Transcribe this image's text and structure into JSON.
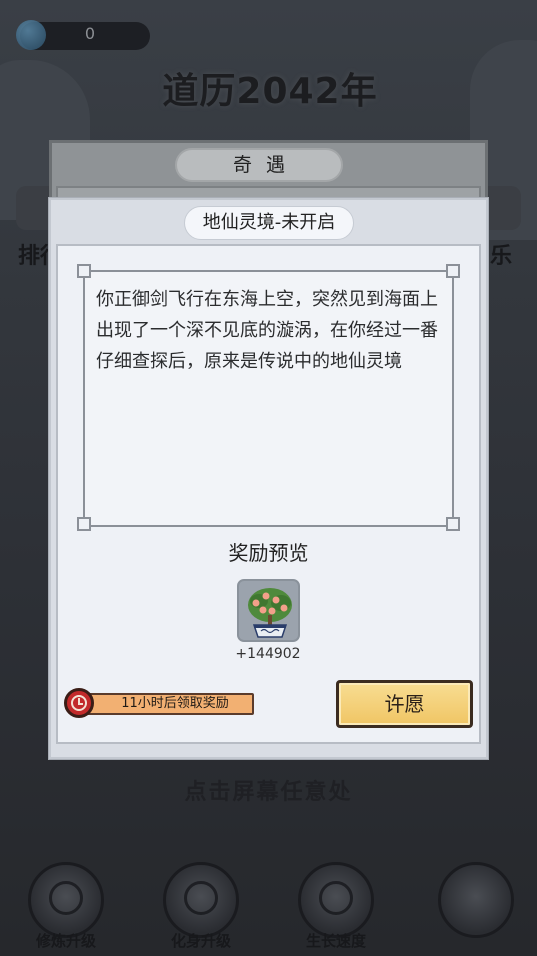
{
  "hud": {
    "currency_count": "0",
    "year_title": "道历2042年"
  },
  "background": {
    "left_label": "排行",
    "right_label": "乐",
    "tap_hint": "点击屏幕任意处",
    "bottom_buttons": [
      {
        "label": "修炼升级",
        "icon": "cultivation-icon"
      },
      {
        "label": "化身升级",
        "icon": "avatar-icon"
      },
      {
        "label": "生长速度",
        "icon": "growth-icon"
      }
    ]
  },
  "back_dialog": {
    "title": "奇遇"
  },
  "dialog": {
    "title": "地仙灵境-未开启",
    "story": "你正御剑飞行在东海上空，突然见到海面上出现了一个深不见底的漩涡，在你经过一番仔细查探后，原来是传说中的地仙灵境",
    "reward_heading": "奖励预览",
    "reward": {
      "icon": "peach-tree-bonsai-icon",
      "amount": "+144902"
    },
    "timer_text": "11小时后领取奖励",
    "wish_button_label": "许愿"
  },
  "colors": {
    "dialog_bg": "#d9dde4",
    "wish_button": "#f0c564",
    "timer_bar": "#f2b072",
    "clock_red": "#c22a2a"
  }
}
